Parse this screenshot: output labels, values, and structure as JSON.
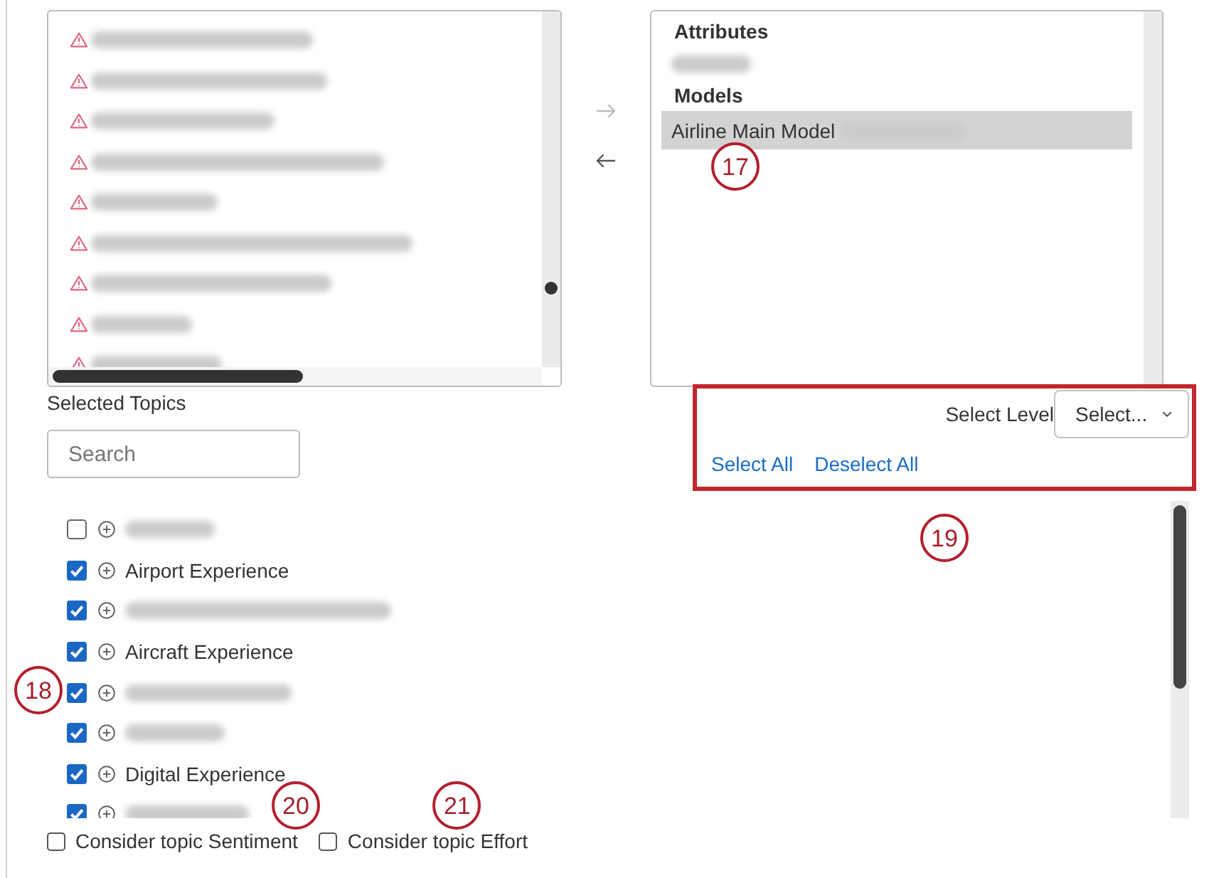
{
  "source_list": {
    "items": [
      {
        "kind": "blurred"
      },
      {
        "kind": "blurred"
      },
      {
        "kind": "blurred"
      },
      {
        "kind": "blurred"
      },
      {
        "kind": "blurred"
      },
      {
        "kind": "blurred"
      },
      {
        "kind": "blurred"
      },
      {
        "kind": "blurred"
      },
      {
        "kind": "blurred"
      }
    ]
  },
  "transfer_buttons": [
    {
      "kind": "right",
      "disabled": true
    },
    {
      "kind": "left",
      "disabled": false
    }
  ],
  "target_list": {
    "groups": [
      {
        "heading": "Attributes",
        "items": [
          {
            "kind": "blurred",
            "selected": false
          }
        ]
      },
      {
        "heading": "Models",
        "items": [
          {
            "kind": "text",
            "label": "Airline Main Model",
            "blurred_suffix": true,
            "selected": true,
            "callout": "17"
          }
        ]
      }
    ]
  },
  "selected_topics": {
    "title": "Selected Topics",
    "search": {
      "placeholder": "Search"
    }
  },
  "level_panel": {
    "highlighted": true,
    "label": "Select Level",
    "dropdown": {
      "placeholder": "Select..."
    },
    "links": [
      "Select All",
      "Deselect All"
    ],
    "callout": "19"
  },
  "topics": [
    {
      "kind": "blurred",
      "checked": false
    },
    {
      "kind": "text",
      "label": "Airport Experience",
      "checked": true
    },
    {
      "kind": "blurred",
      "checked": true
    },
    {
      "kind": "text",
      "label": "Aircraft Experience",
      "checked": true
    },
    {
      "kind": "blurred",
      "checked": true,
      "callout": "18"
    },
    {
      "kind": "blurred",
      "checked": true
    },
    {
      "kind": "text",
      "label": "Digital Experience",
      "checked": true
    },
    {
      "kind": "blurred",
      "checked": true
    }
  ],
  "options": [
    {
      "label": "Consider topic Sentiment",
      "checked": false,
      "callout": "20"
    },
    {
      "label": "Consider topic Effort",
      "checked": false,
      "callout": "21"
    }
  ]
}
